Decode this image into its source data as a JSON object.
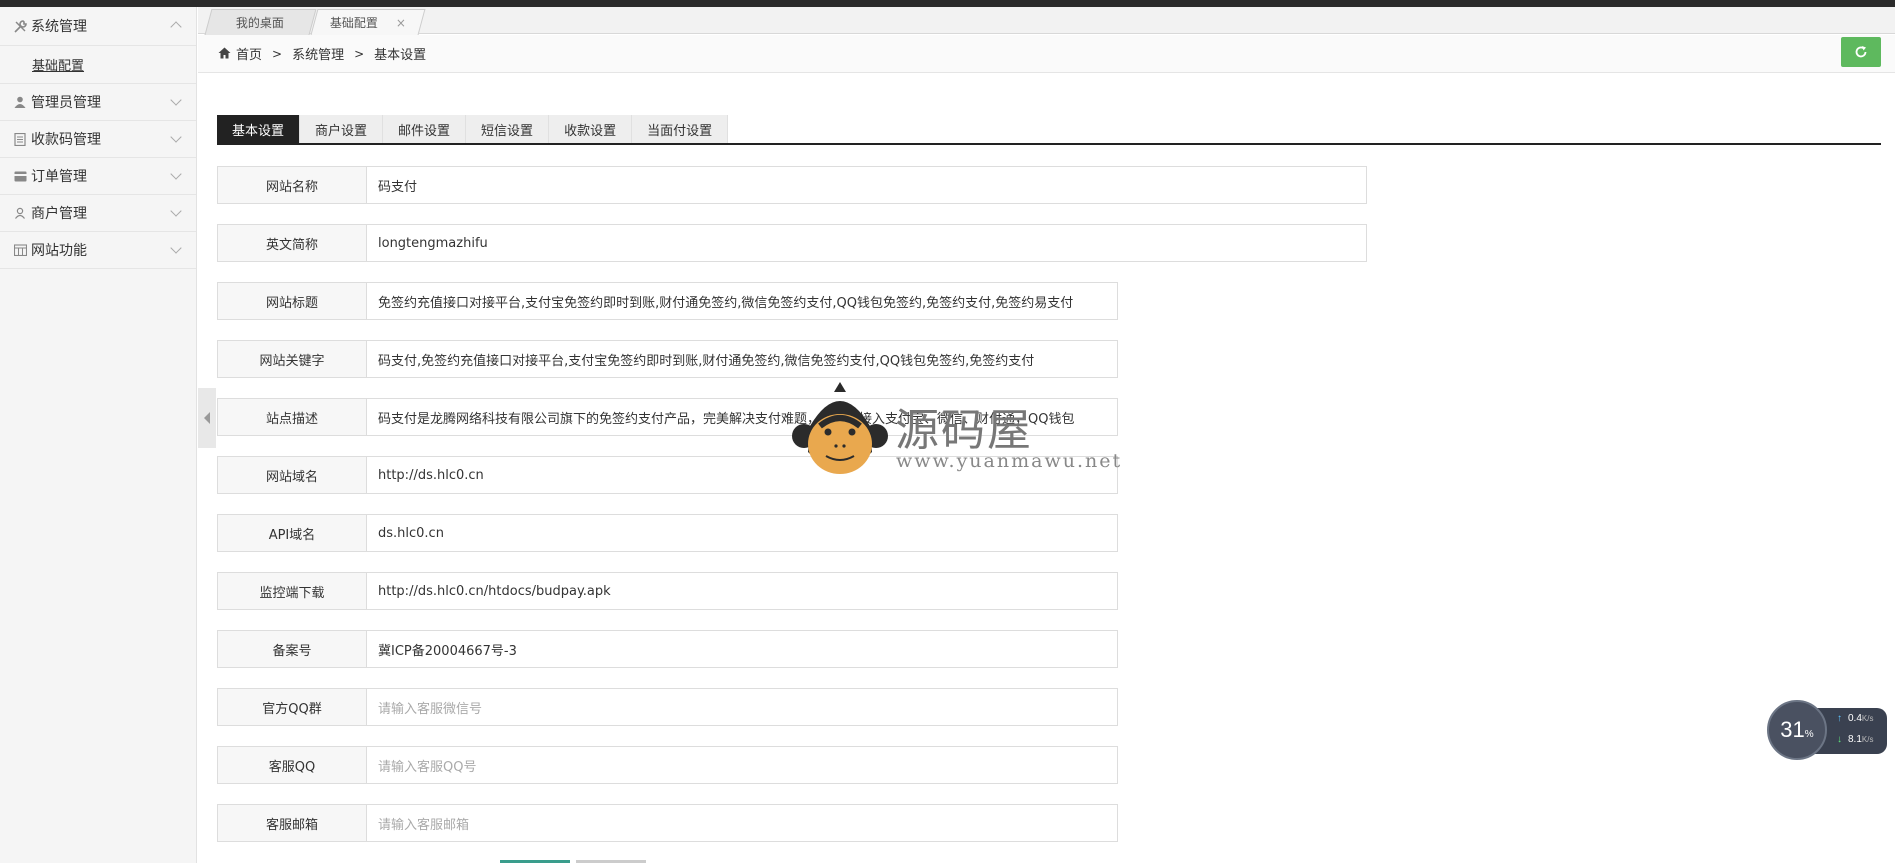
{
  "sidebar": {
    "items": [
      {
        "label": "系统管理",
        "icon": "wrench-icon",
        "expanded": true
      },
      {
        "label": "管理员管理",
        "icon": "user-icon"
      },
      {
        "label": "收款码管理",
        "icon": "document-icon"
      },
      {
        "label": "订单管理",
        "icon": "card-icon"
      },
      {
        "label": "商户管理",
        "icon": "person-icon"
      },
      {
        "label": "网站功能",
        "icon": "calendar-icon"
      }
    ],
    "submenu": {
      "label": "基础配置"
    }
  },
  "tabs": [
    {
      "label": "我的桌面"
    },
    {
      "label": "基础配置",
      "close": "×",
      "active": true
    }
  ],
  "breadcrumb": {
    "home": "首页",
    "sep1": ">",
    "level1": "系统管理",
    "sep2": ">",
    "level2": "基本设置"
  },
  "settings_tabs": [
    {
      "label": "基本设置",
      "active": true
    },
    {
      "label": "商户设置"
    },
    {
      "label": "邮件设置"
    },
    {
      "label": "短信设置"
    },
    {
      "label": "收款设置"
    },
    {
      "label": "当面付设置"
    }
  ],
  "form": [
    {
      "label": "网站名称",
      "value": "码支付"
    },
    {
      "label": "英文简称",
      "value": "longtengmazhifu"
    },
    {
      "label": "网站标题",
      "value": "免签约充值接口对接平台,支付宝免签约即时到账,财付通免签约,微信免签约支付,QQ钱包免签约,免签约支付,免签约易支付"
    },
    {
      "label": "网站关键字",
      "value": "码支付,免签约充值接口对接平台,支付宝免签约即时到账,财付通免签约,微信免签约支付,QQ钱包免签约,免签约支付"
    },
    {
      "label": "站点描述",
      "value": "码支付是龙腾网络科技有限公司旗下的免签约支付产品，完美解决支付难题，一站式接入支付宝、微信、财付通，QQ钱包"
    },
    {
      "label": "网站域名",
      "value": "http://ds.hlc0.cn"
    },
    {
      "label": "API域名",
      "value": "ds.hlc0.cn"
    },
    {
      "label": "监控端下载",
      "value": "http://ds.hlc0.cn/htdocs/budpay.apk"
    },
    {
      "label": "备案号",
      "value": "冀ICP备20004667号-3"
    },
    {
      "label": "官方QQ群",
      "placeholder": "请输入客服微信号"
    },
    {
      "label": "客服QQ",
      "placeholder": "请输入客服QQ号"
    },
    {
      "label": "客服邮箱",
      "placeholder": "请输入客服邮箱"
    }
  ],
  "watermark": {
    "title": "源码屋",
    "url": "www.yuanmawu.net"
  },
  "speed": {
    "percent": "31",
    "percent_unit": "%",
    "up": "0.4",
    "down": "8.1",
    "unit": "K/s"
  },
  "colors": {
    "accent_green": "#5eb95e",
    "dark": "#222222"
  }
}
